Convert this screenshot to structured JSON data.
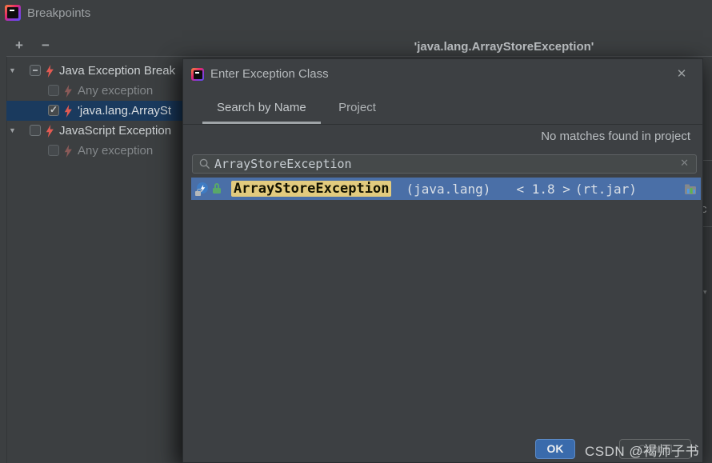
{
  "window": {
    "title": "Breakpoints",
    "detail_header": "'java.lang.ArrayStoreException'",
    "toolbar": {
      "add": "+",
      "remove": "−"
    }
  },
  "tree": {
    "items": [
      {
        "label": "Java Exception Break",
        "type": "group",
        "checkbox": "indeterminate",
        "muted": false,
        "selected": false
      },
      {
        "label": "Any exception",
        "type": "child",
        "checkbox": "unchecked",
        "muted": true,
        "selected": false
      },
      {
        "label": "'java.lang.ArraySt",
        "type": "child",
        "checkbox": "checked",
        "muted": false,
        "selected": true
      },
      {
        "label": "JavaScript Exception",
        "type": "group",
        "checkbox": "unchecked",
        "muted": false,
        "selected": false
      },
      {
        "label": "Any exception",
        "type": "child",
        "checkbox": "unchecked",
        "muted": true,
        "selected": false
      }
    ]
  },
  "dialog": {
    "title": "Enter Exception Class",
    "tabs": [
      {
        "label": "Search by Name",
        "active": true
      },
      {
        "label": "Project",
        "active": false
      }
    ],
    "status": "No matches found in project",
    "search": {
      "value": "ArrayStoreException"
    },
    "result": {
      "name": "ArrayStoreException",
      "package": "(java.lang)",
      "version": "< 1.8 >",
      "jar": "(rt.jar)"
    },
    "buttons": {
      "ok": "OK",
      "cancel": "Cancel"
    }
  },
  "icons": {
    "expand": "▼",
    "close": "✕",
    "clear": "✕",
    "caret_fragment": "▾"
  },
  "fragments": {
    "right_edge_text": "c"
  },
  "watermark": "CSDN @褐师子书",
  "colors": {
    "background": "#3c3f41",
    "tree_selection": "#1a3a5e",
    "result_row": "#4a6fa7",
    "match_highlight": "#e2cb7e",
    "ok_button": "#3a6bac",
    "breakpoint_red": "#e25a52",
    "breakpoint_muted": "#8a5a58"
  }
}
